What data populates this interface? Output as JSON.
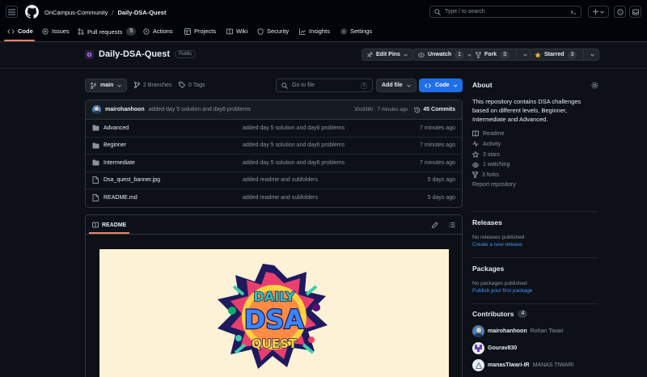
{
  "header": {
    "org": "OnCampus-Community",
    "separator": "/",
    "repo": "Daily-DSA-Quest",
    "search_placeholder": "Type / to search",
    "search_key": "/"
  },
  "tabs": [
    {
      "label": "Code"
    },
    {
      "label": "Issues"
    },
    {
      "label": "Pull requests",
      "count": "5"
    },
    {
      "label": "Actions"
    },
    {
      "label": "Projects"
    },
    {
      "label": "Wiki"
    },
    {
      "label": "Security"
    },
    {
      "label": "Insights"
    },
    {
      "label": "Settings"
    }
  ],
  "repo_header": {
    "name": "Daily-DSA-Quest",
    "visibility": "Public",
    "edit_pins": "Edit Pins",
    "unwatch": "Unwatch",
    "unwatch_count": "1",
    "fork": "Fork",
    "fork_count": "3",
    "starred": "Starred",
    "star_count": "3"
  },
  "toolbar": {
    "branch": "main",
    "branches": "2 Branches",
    "tags": "0 Tags",
    "goto_placeholder": "Go to file",
    "goto_key": "t",
    "add_file": "Add file",
    "code": "Code"
  },
  "commit": {
    "author": "mairohanhoon",
    "message": "added day 5 solution and day6 problems",
    "meta": "30c8380 · 7 minutes ago",
    "count": "45 Commits"
  },
  "files": [
    {
      "type": "folder",
      "name": "Advanced",
      "message": "added day 5 solution and day6 problems",
      "date": "7 minutes ago"
    },
    {
      "type": "folder",
      "name": "Beginner",
      "message": "added day 5 solution and day6 problems",
      "date": "7 minutes ago"
    },
    {
      "type": "folder",
      "name": "Intermediate",
      "message": "added day 5 solution and day6 problems",
      "date": "7 minutes ago"
    },
    {
      "type": "file",
      "name": "Dsa_quest_banner.jpg",
      "message": "added readme and subfolders",
      "date": "5 days ago"
    },
    {
      "type": "file",
      "name": "README.md",
      "message": "added readme and subfolders",
      "date": "5 days ago"
    }
  ],
  "readme": {
    "tab": "README",
    "logo_line1": "DAILY",
    "logo_line2": "DSA",
    "logo_line3": "QUEST"
  },
  "about": {
    "title": "About",
    "description": "This repository contains DSA challenges based on different levels, Beginner, Intermediate and Advanced.",
    "readme": "Readme",
    "activity": "Activity",
    "stars": "3 stars",
    "watching": "1 watching",
    "forks": "3 forks",
    "report": "Report repository"
  },
  "releases": {
    "title": "Releases",
    "empty": "No releases published",
    "create": "Create a new release"
  },
  "packages": {
    "title": "Packages",
    "empty": "No packages published",
    "publish": "Publish your first package"
  },
  "contributors": {
    "title": "Contributors",
    "count": "4",
    "list": [
      {
        "login": "mairohanhoon",
        "name": "Rohan Tiwari"
      },
      {
        "login": "Gourav830",
        "name": ""
      },
      {
        "login": "manasTiwari-IR",
        "name": "MANAS TIWARI"
      }
    ]
  },
  "colors": {
    "accent": "#1f6feb",
    "underline": "#f78166",
    "bg": "#0d1117",
    "star": "#e3b341"
  }
}
